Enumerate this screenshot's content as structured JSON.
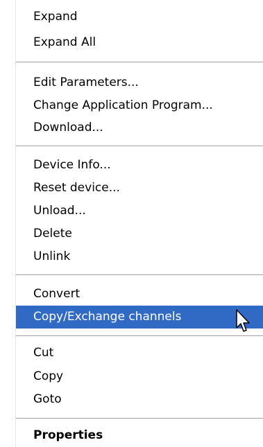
{
  "context_menu": {
    "groups": [
      {
        "items": [
          "Expand",
          "Expand All"
        ]
      },
      {
        "items": [
          "Edit Parameters...",
          "Change Application Program...",
          "Download..."
        ]
      },
      {
        "items": [
          "Device Info...",
          "Reset device...",
          "Unload...",
          "Delete",
          "Unlink"
        ]
      },
      {
        "items": [
          "Convert",
          "Copy/Exchange channels"
        ]
      },
      {
        "items": [
          "Cut",
          "Copy",
          "Goto"
        ]
      },
      {
        "items": [
          "Properties"
        ]
      }
    ],
    "highlighted_item": "Copy/Exchange channels",
    "default_item": "Properties",
    "highlight_color": "#316ac5",
    "cursor_icon": "arrow-cursor-icon"
  }
}
